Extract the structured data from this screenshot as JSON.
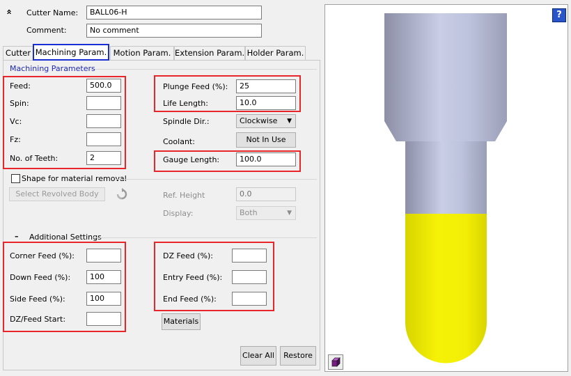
{
  "header": {
    "collapse_glyph": "»",
    "cutter_name_label": "Cutter Name:",
    "cutter_name_value": "BALL06-H",
    "comment_label": "Comment:",
    "comment_value": "No comment"
  },
  "tabs": [
    "Cutter",
    "Machining Param.",
    "Motion Param.",
    "Extension Param.",
    "Holder Param."
  ],
  "active_tab": "Machining Param.",
  "machining": {
    "group_title": "Machining Parameters",
    "feed_label": "Feed:",
    "feed_value": "500.0",
    "spin_label": "Spin:",
    "spin_value": "",
    "vc_label": "Vc:",
    "vc_value": "",
    "fz_label": "Fz:",
    "fz_value": "",
    "teeth_label": "No. of Teeth:",
    "teeth_value": "2",
    "plunge_label": "Plunge Feed (%):",
    "plunge_value": "25",
    "life_label": "Life Length:",
    "life_value": "10.0",
    "spindle_label": "Spindle Dir.:",
    "spindle_value": "Clockwise",
    "coolant_label": "Coolant:",
    "coolant_button": "Not In Use",
    "gauge_label": "Gauge Length:",
    "gauge_value": "100.0"
  },
  "shape": {
    "checkbox_label": "Shape for material removal",
    "checked": false,
    "select_body_button": "Select Revolved Body",
    "ref_height_label": "Ref. Height",
    "ref_height_value": "0.0",
    "display_label": "Display:",
    "display_value": "Both"
  },
  "additional": {
    "toggle_glyph": "–",
    "title": "Additional Settings",
    "corner_label": "Corner Feed (%):",
    "corner_value": "",
    "down_label": "Down Feed (%):",
    "down_value": "100",
    "side_label": "Side Feed (%):",
    "side_value": "100",
    "dzstart_label": "DZ/Feed Start:",
    "dzstart_value": "",
    "dz_label": "DZ Feed (%):",
    "dz_value": "",
    "entry_label": "Entry Feed (%):",
    "entry_value": "",
    "end_label": "End Feed (%):",
    "end_value": "",
    "materials_button": "Materials"
  },
  "footer": {
    "clear_all": "Clear All",
    "restore": "Restore"
  },
  "preview": {
    "help_glyph": "?",
    "colors": {
      "shank": "#b9bed8",
      "flute": "#f2ee05",
      "help": "#2a55c8"
    },
    "view_cube_icon": "view-cube-icon"
  }
}
